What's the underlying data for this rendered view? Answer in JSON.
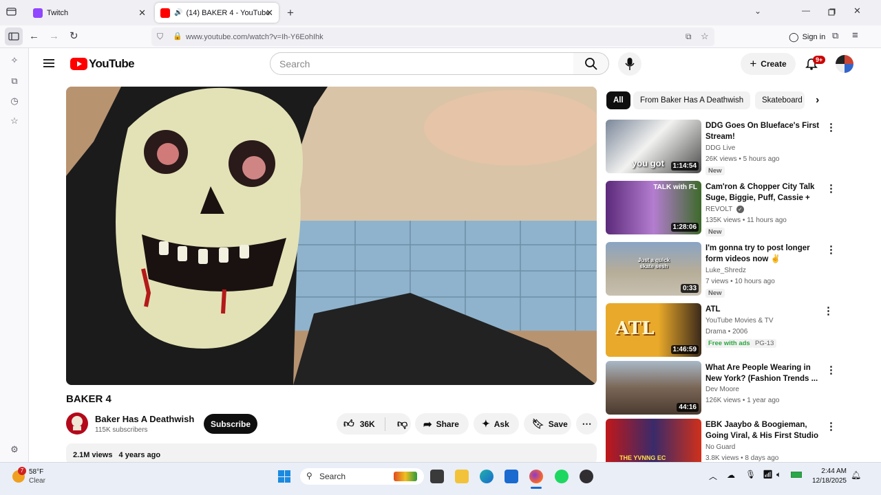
{
  "browser": {
    "tabs": [
      {
        "title": "Twitch",
        "active": false
      },
      {
        "title": "(14) BAKER 4 - YouTube",
        "active": true
      }
    ],
    "url": "www.youtube.com/watch?v=Ih-Y6EohIhk",
    "sign_in": "Sign in"
  },
  "youtube": {
    "logo_text": "YouTube",
    "search_placeholder": "Search",
    "create_label": "Create",
    "notification_badge": "9+",
    "video": {
      "title": "BAKER 4",
      "channel": "Baker Has A Deathwish",
      "subscribers": "115K subscribers",
      "subscribe_label": "Subscribe",
      "likes": "36K",
      "share_label": "Share",
      "ask_label": "Ask",
      "save_label": "Save",
      "views": "2.1M views",
      "age": "4 years ago"
    },
    "chips": [
      "All",
      "From Baker Has A Deathwish",
      "Skateboard"
    ],
    "recommendations": [
      {
        "title": "DDG Goes On Blueface's First Stream!",
        "channel": "DDG Live",
        "meta": "26K views • 5 hours ago",
        "badge": "New",
        "duration": "1:14:54",
        "thumb_caption": "you got"
      },
      {
        "title": "Cam'ron & Chopper City Talk Suge, Biggie, Puff, Cassie + Mr...",
        "channel": "REVOLT",
        "meta": "135K views • 11 hours ago",
        "badge": "New",
        "duration": "1:28:06",
        "thumb_caption": "TALK with FL"
      },
      {
        "title": "I'm gonna try to post longer form videos now ✌",
        "channel": "Luke_Shredz",
        "meta": "7 views • 10 hours ago",
        "badge": "New",
        "duration": "0:33",
        "thumb_caption": "Just a quick skate sesh"
      },
      {
        "title": "ATL",
        "channel": "YouTube Movies & TV",
        "meta": "Drama • 2006",
        "badge": "PG-13",
        "free": "Free with ads",
        "duration": "1:46:59",
        "thumb_caption": "ATL"
      },
      {
        "title": "What Are People Wearing in New York? (Fashion Trends ...",
        "channel": "Dev Moore",
        "meta": "126K views • 1 year ago",
        "duration": "44:16"
      },
      {
        "title": "EBK Jaaybo & Boogieman, Going Viral, & His First Studio |...",
        "channel": "No Guard",
        "meta": "3.8K views • 8 days ago",
        "thumb_caption": "THE YVNNG EC"
      }
    ]
  },
  "taskbar": {
    "weather_temp": "58°F",
    "weather_desc": "Clear",
    "weather_badge": "7",
    "search_label": "Search",
    "time": "2:44 AM",
    "date": "12/18/2025"
  },
  "colors": {
    "yt_red": "#ff0000",
    "text": "#0f0f0f",
    "muted": "#606060",
    "chip_bg": "#f2f2f2",
    "free_green": "#2ba640"
  }
}
